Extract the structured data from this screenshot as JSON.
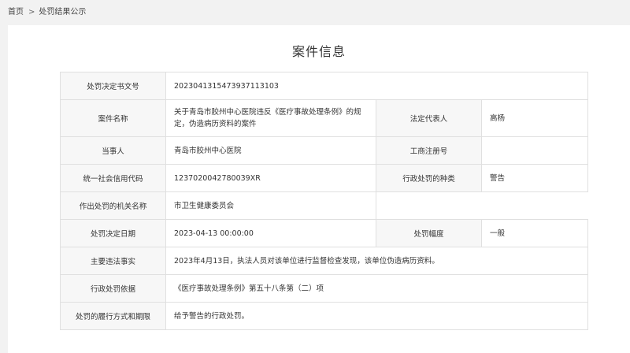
{
  "breadcrumb": {
    "home": "首页",
    "separator": ">",
    "current": "处罚结果公示"
  },
  "page_title": "案件信息",
  "case": {
    "decision_no_label": "处罚决定书文号",
    "decision_no": "2023041315473937113103",
    "case_name_label": "案件名称",
    "case_name": "关于青岛市胶州中心医院违反《医疗事故处理条例》的规定，伪造病历资料的案件",
    "legal_rep_label": "法定代表人",
    "legal_rep": "高杨",
    "party_label": "当事人",
    "party": "青岛市胶州中心医院",
    "biz_reg_label": "工商注册号",
    "biz_reg": "",
    "credit_code_label": "统一社会信用代码",
    "credit_code": "1237020042780039XR",
    "penalty_type_label": "行政处罚的种类",
    "penalty_type": "警告",
    "authority_label": "作出处罚的机关名称",
    "authority": "市卫生健康委员会",
    "decision_date_label": "处罚决定日期",
    "decision_date": "2023-04-13 00:00:00",
    "penalty_range_label": "处罚幅度",
    "penalty_range": "一般",
    "facts_label": "主要违法事实",
    "facts": "2023年4月13日，执法人员对该单位进行监督检查发现，该单位伪造病历资料。",
    "basis_label": "行政处罚依据",
    "basis": "《医疗事故处理条例》第五十八条第（二）项",
    "fulfillment_label": "处罚的履行方式和期限",
    "fulfillment": "给予警告的行政处罚。"
  }
}
